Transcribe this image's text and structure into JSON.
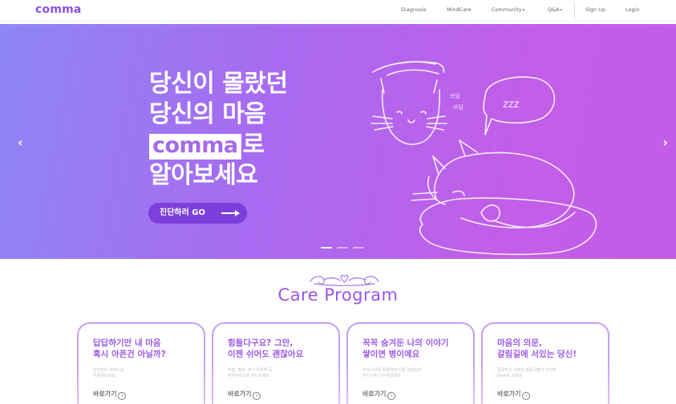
{
  "nav": {
    "logo": "comma",
    "items": [
      {
        "label": "Diagnosis",
        "caret": ""
      },
      {
        "label": "MindCare",
        "caret": ""
      },
      {
        "label": "Community",
        "caret": "▾"
      },
      {
        "label": "Q&A",
        "caret": "▾"
      },
      {
        "label": "Sign Up",
        "caret": ""
      },
      {
        "label": "Login",
        "caret": ""
      }
    ]
  },
  "hero": {
    "line1": "당신이 몰랐던",
    "line2": "당신의 마음",
    "brand": "comma",
    "brand_suffix": "로",
    "line4": "알아보세요",
    "cta_label": "진단하러 GO",
    "bubble_text": "zzz",
    "pat_text_1": "쓰담",
    "pat_text_2": "쓰담",
    "prev_arrow": "‹",
    "next_arrow": "›",
    "slide_count": 3,
    "active_slide": 1
  },
  "care": {
    "title": "Care Program",
    "cards": [
      {
        "title_1": "답답하기만 내 마음",
        "title_2": "혹시 아픈건 아닐까?",
        "desc_1": "심리진단 서비스를",
        "desc_2": "이용해보세요.",
        "link": "바로가기",
        "link_icon": "›"
      },
      {
        "title_1": "힘들다구요? 그만,",
        "title_2": "이젠 쉬어도 괜찮아요",
        "desc_1": "미술, 명상, 향기 치유와 등",
        "desc_2": "케어서비스를 만나보세요",
        "link": "바로가기",
        "link_icon": "›"
      },
      {
        "title_1": "꼭꼭 숨겨둔 나의 이야기",
        "title_2": "쌓이면 병이에요",
        "desc_1": "커뮤니티를 활용하여 다른 회원님과",
        "desc_2": "이야기를 나누어보세요",
        "link": "바로가기",
        "link_icon": "›"
      },
      {
        "title_1": "마음의 의문,",
        "title_2": "갈림길에 서있는 당신!",
        "desc_1": "궁금하신 사항과 질문사항이 있다면",
        "desc_2": "Q&A로 오세요",
        "link": "바로가기",
        "link_icon": "›"
      }
    ]
  },
  "colors": {
    "brand": "#8a4fe8",
    "hero_gradient_start": "#8e86f5",
    "hero_gradient_end": "#c35ce6",
    "cta": "#7d3fdc",
    "card_title": "#9c5be6"
  }
}
